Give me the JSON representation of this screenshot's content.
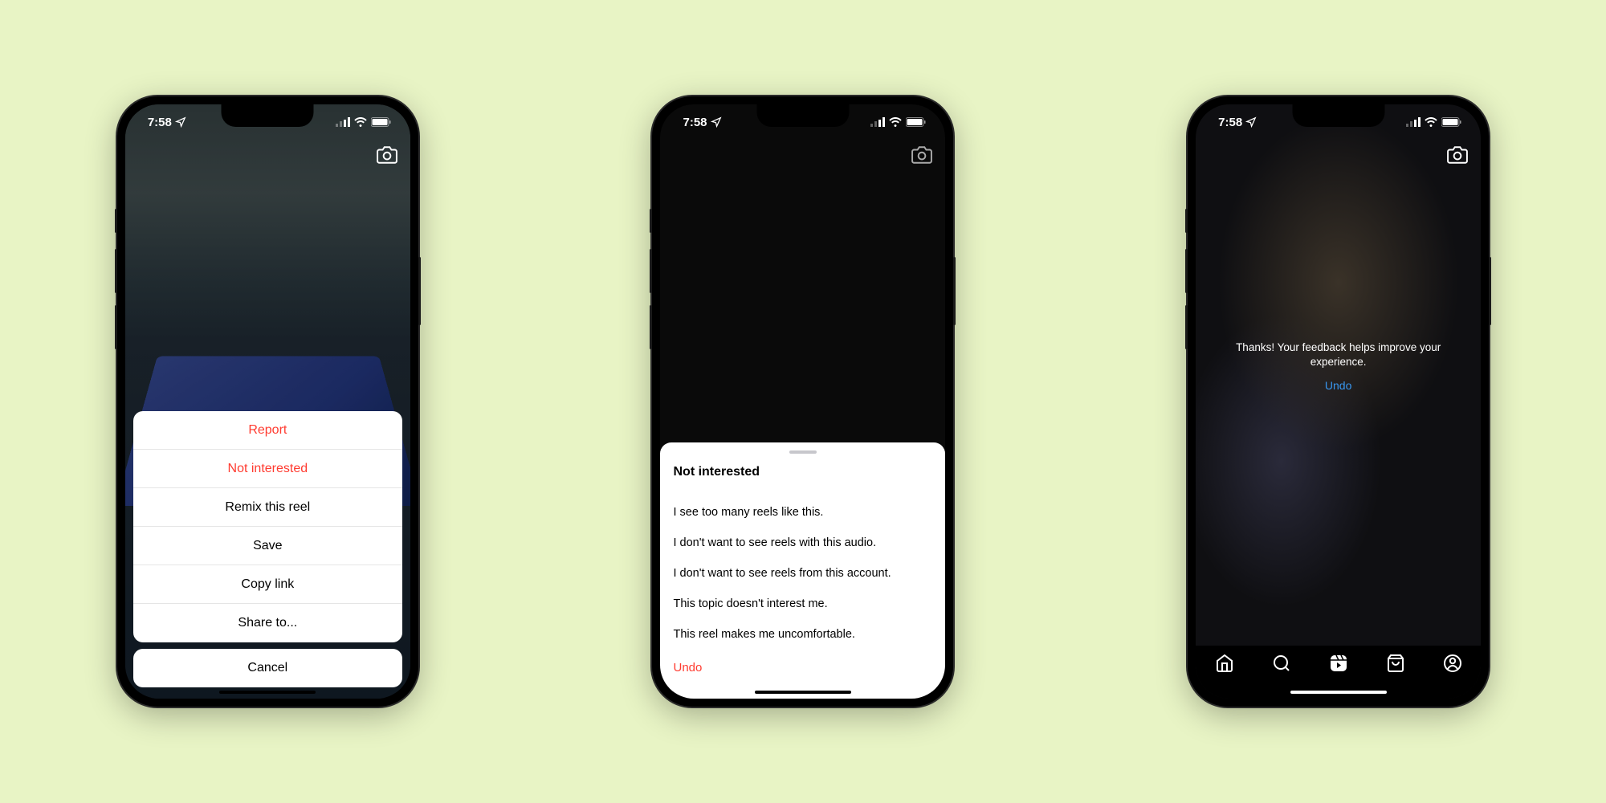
{
  "statusBar": {
    "time": "7:58"
  },
  "screen1": {
    "actionSheet": {
      "items": [
        {
          "label": "Report",
          "destructive": true
        },
        {
          "label": "Not interested",
          "destructive": true
        },
        {
          "label": "Remix this reel",
          "destructive": false
        },
        {
          "label": "Save",
          "destructive": false
        },
        {
          "label": "Copy link",
          "destructive": false
        },
        {
          "label": "Share to...",
          "destructive": false
        }
      ],
      "cancel": "Cancel"
    }
  },
  "screen2": {
    "sheet": {
      "title": "Not interested",
      "reasons": [
        "I see too many reels like this.",
        "I don't want to see reels with this audio.",
        "I don't want to see reels from this account.",
        "This topic doesn't interest me.",
        "This reel makes me uncomfortable."
      ],
      "undo": "Undo"
    }
  },
  "screen3": {
    "thanks": "Thanks! Your feedback helps improve your experience.",
    "undo": "Undo",
    "tabs": [
      "home",
      "search",
      "reels",
      "shop",
      "profile"
    ]
  }
}
